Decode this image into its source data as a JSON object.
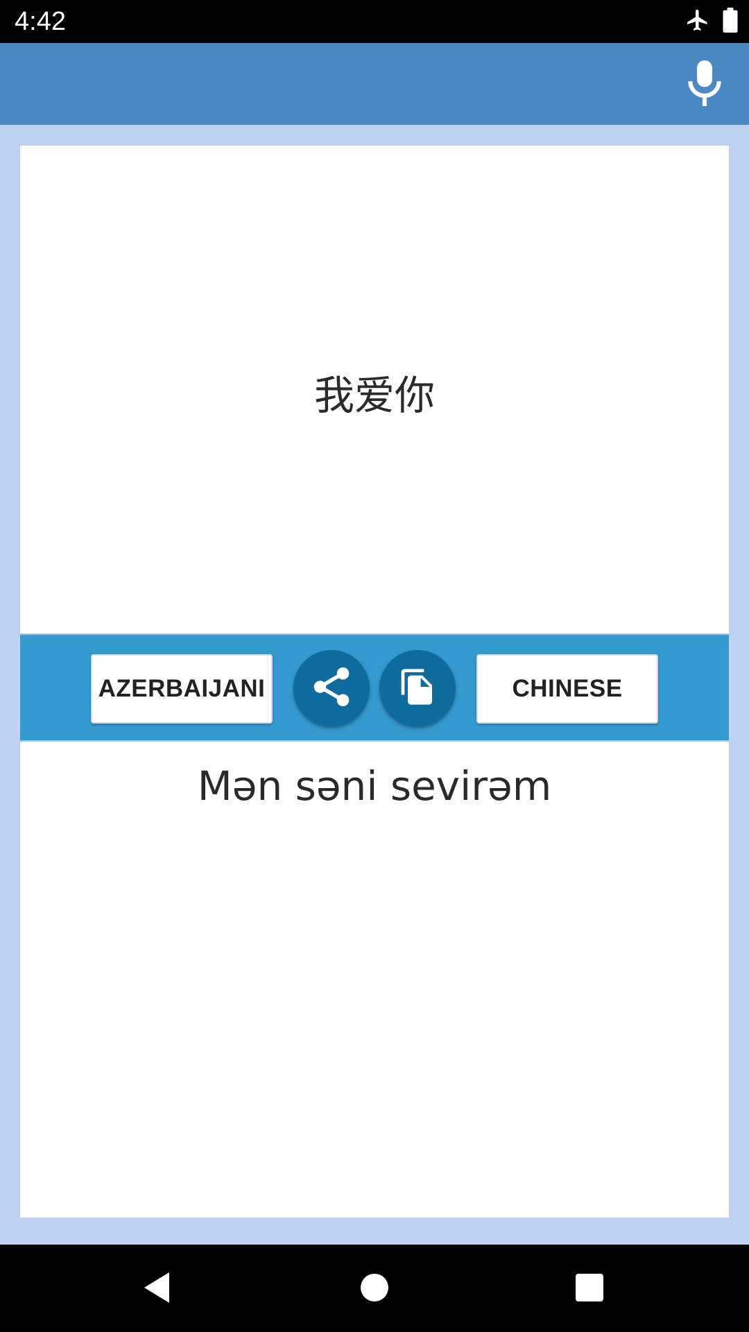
{
  "status_bar": {
    "time": "4:42",
    "icons": [
      "airplane-mode-icon",
      "battery-icon"
    ]
  },
  "app_bar": {
    "action_icon": "microphone-icon"
  },
  "source_panel": {
    "text": "我爱你"
  },
  "toolbar": {
    "source_language": "AZERBAIJANI",
    "target_language": "CHINESE",
    "share_icon": "share-icon",
    "copy_icon": "copy-icon"
  },
  "target_panel": {
    "text": "Mən səni sevirəm"
  },
  "nav_bar": {
    "icons": [
      "back-icon",
      "home-icon",
      "recents-icon"
    ]
  },
  "colors": {
    "app_bar": "#4b89c5",
    "background": "#c0d2f1",
    "toolbar": "#3499cf",
    "round_button": "#0d6b9e"
  }
}
